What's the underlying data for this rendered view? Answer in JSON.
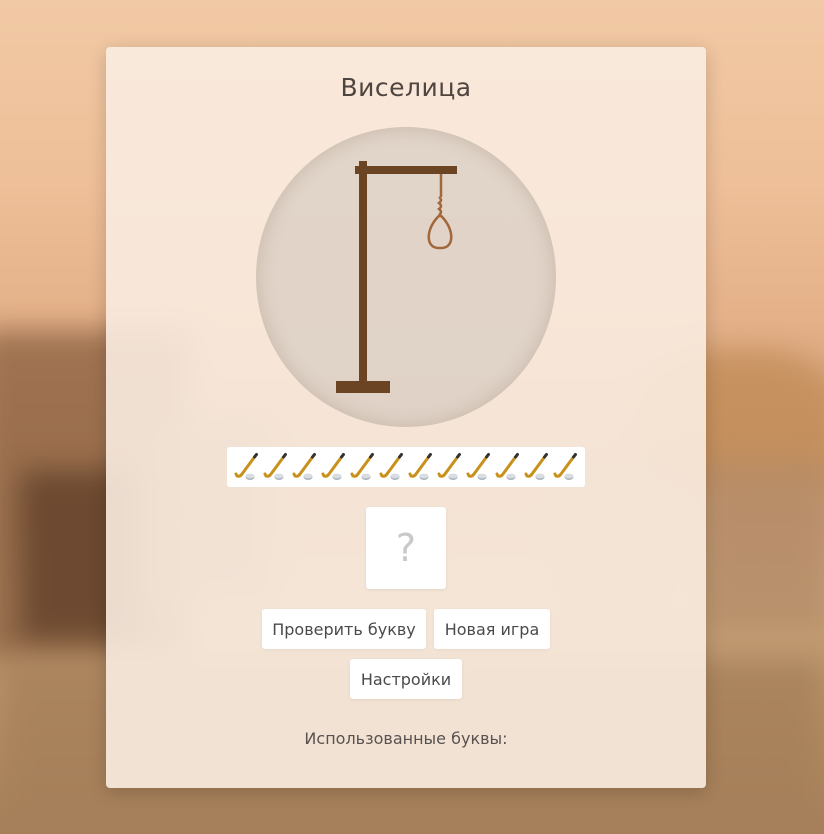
{
  "game": {
    "title": "Виселица",
    "gallows_icon": "gallows-with-noose",
    "lives": {
      "count": 12,
      "remaining": 12,
      "icon": "hockey-stick-and-puck",
      "stick_color": "#c8911c",
      "puck_color": "#a9b4bd"
    },
    "letter_input": {
      "value": "",
      "placeholder": "?"
    },
    "buttons": {
      "check_letter": "Проверить букву",
      "new_game": "Новая игра",
      "settings": "Настройки"
    },
    "used_letters": {
      "label": "Использованные буквы:",
      "letters": ""
    }
  },
  "colors": {
    "wood": "#6b4423",
    "rope": "#a2673a",
    "card": "#faece0",
    "text": "#4e4540"
  }
}
